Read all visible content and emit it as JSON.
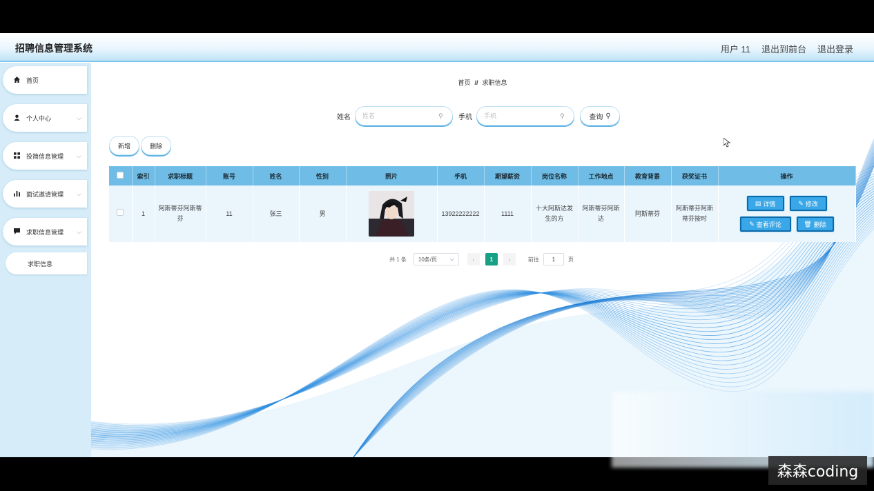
{
  "app": {
    "title": "招聘信息管理系统"
  },
  "header": {
    "user_label": "用户 11",
    "front_label": "退出到前台",
    "logout_label": "退出登录"
  },
  "sidebar": {
    "items": [
      {
        "label": "首页",
        "icon": "home-icon"
      },
      {
        "label": "个人中心",
        "icon": "user-icon"
      },
      {
        "label": "投简信息管理",
        "icon": "grid-icon"
      },
      {
        "label": "面试邀请管理",
        "icon": "bar-chart-icon"
      },
      {
        "label": "求职信息管理",
        "icon": "message-icon"
      }
    ],
    "sub_item": "求职信息"
  },
  "breadcrumb": {
    "home": "首页",
    "sep": "//",
    "current": "求职信息"
  },
  "search": {
    "name_label": "姓名",
    "name_placeholder": "姓名",
    "phone_label": "手机",
    "phone_placeholder": "手机",
    "query_label": "查询"
  },
  "actions": {
    "add": "新增",
    "delete": "删除"
  },
  "table": {
    "columns": [
      "索引",
      "求职标题",
      "账号",
      "姓名",
      "性别",
      "照片",
      "手机",
      "期望薪资",
      "岗位名称",
      "工作地点",
      "教育背景",
      "获奖证书",
      "操作"
    ],
    "rows": [
      {
        "index": "1",
        "title": "阿斯蒂芬阿斯蒂芬",
        "account": "11",
        "name": "张三",
        "gender": "男",
        "phone": "13922222222",
        "salary": "1111",
        "position": "十大阿斯达发生的方",
        "location": "阿斯蒂芬阿斯达",
        "education": "阿斯蒂芬",
        "award": "阿斯蒂芬阿斯蒂芬按时"
      }
    ],
    "ops": {
      "detail": "详情",
      "edit": "修改",
      "comments": "查看评论",
      "delete": "删除"
    }
  },
  "pager": {
    "total": "共 1 条",
    "size": "10条/页",
    "current": "1",
    "goto_label": "前往",
    "goto_value": "1",
    "page_unit": "页"
  },
  "watermark": "森森coding",
  "colors": {
    "accent": "#6fbde6",
    "button": "#3aa8e8",
    "active_page": "#17a085",
    "sidebar_bg": "#d6ecf8"
  }
}
